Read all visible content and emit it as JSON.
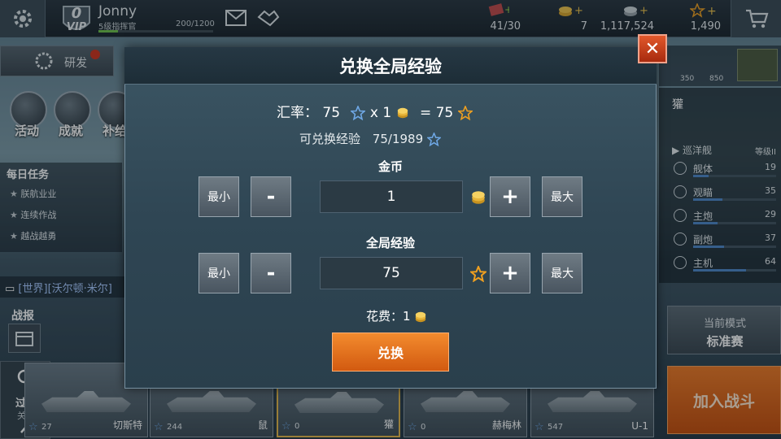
{
  "colors": {
    "accent_orange": "#e8731f",
    "close_red": "#c0401a",
    "star_blue": "#6fa8e6",
    "star_gold": "#f0a020",
    "coin_gold": "#e7b83a"
  },
  "topbar": {
    "vip_level": "0",
    "vip_label": "VIP",
    "username": "Jonny",
    "rank": "5级指挥官",
    "xp": "200/1200",
    "xp_fraction": 0.167,
    "resources": [
      {
        "icon": "fuel-icon",
        "value": "41/30"
      },
      {
        "icon": "gold-coin-icon",
        "value": "7"
      },
      {
        "icon": "silver-coin-icon",
        "value": "1,117,524"
      },
      {
        "icon": "star-icon",
        "value": "1,490"
      }
    ]
  },
  "left": {
    "tab_label": "研发",
    "medals": [
      "活动",
      "成就",
      "补给"
    ],
    "daily_title": "每日任务",
    "tasks": [
      "朕航业业",
      "连续作战",
      "越战越勇"
    ],
    "chat": "[世界][沃尔顿·米尔]",
    "battle_report": "战报",
    "filter": {
      "label": "过滤",
      "sub": "关闭"
    }
  },
  "right": {
    "ship_name": "獾",
    "ship_type": "巡洋舰",
    "ship_grade": "等级II",
    "stars_a": "350",
    "stars_b": "850",
    "stats": [
      {
        "name": "舰体",
        "value": "19",
        "fraction": 0.19
      },
      {
        "name": "观瞄",
        "value": "35",
        "fraction": 0.35
      },
      {
        "name": "主炮",
        "value": "29",
        "fraction": 0.29
      },
      {
        "name": "副炮",
        "value": "37",
        "fraction": 0.37
      },
      {
        "name": "主机",
        "value": "64",
        "fraction": 0.64
      }
    ],
    "mode_title": "当前模式",
    "mode_value": "标准赛",
    "join_label": "加入战斗"
  },
  "ships": [
    {
      "name": "切斯特",
      "level": "27"
    },
    {
      "name": "鼠",
      "level": "244"
    },
    {
      "name": "獾",
      "level": "0"
    },
    {
      "name": "赫梅林",
      "level": "0"
    },
    {
      "name": "U-1",
      "level": "547"
    }
  ],
  "dialog": {
    "title": "兑换全局经验",
    "rate_label": "汇率：",
    "rate_stars": "75",
    "rate_mult": "x 1",
    "rate_eq": "= 75",
    "available_label": "可兑换经验",
    "available_value": "75/1989",
    "gold_label": "金币",
    "gold_value": "1",
    "xp_label": "全局经验",
    "xp_value": "75",
    "min_label": "最小",
    "max_label": "最大",
    "minus": "-",
    "plus": "+",
    "cost_label": "花费：1",
    "exchange_label": "兑换",
    "close_label": "✕"
  }
}
